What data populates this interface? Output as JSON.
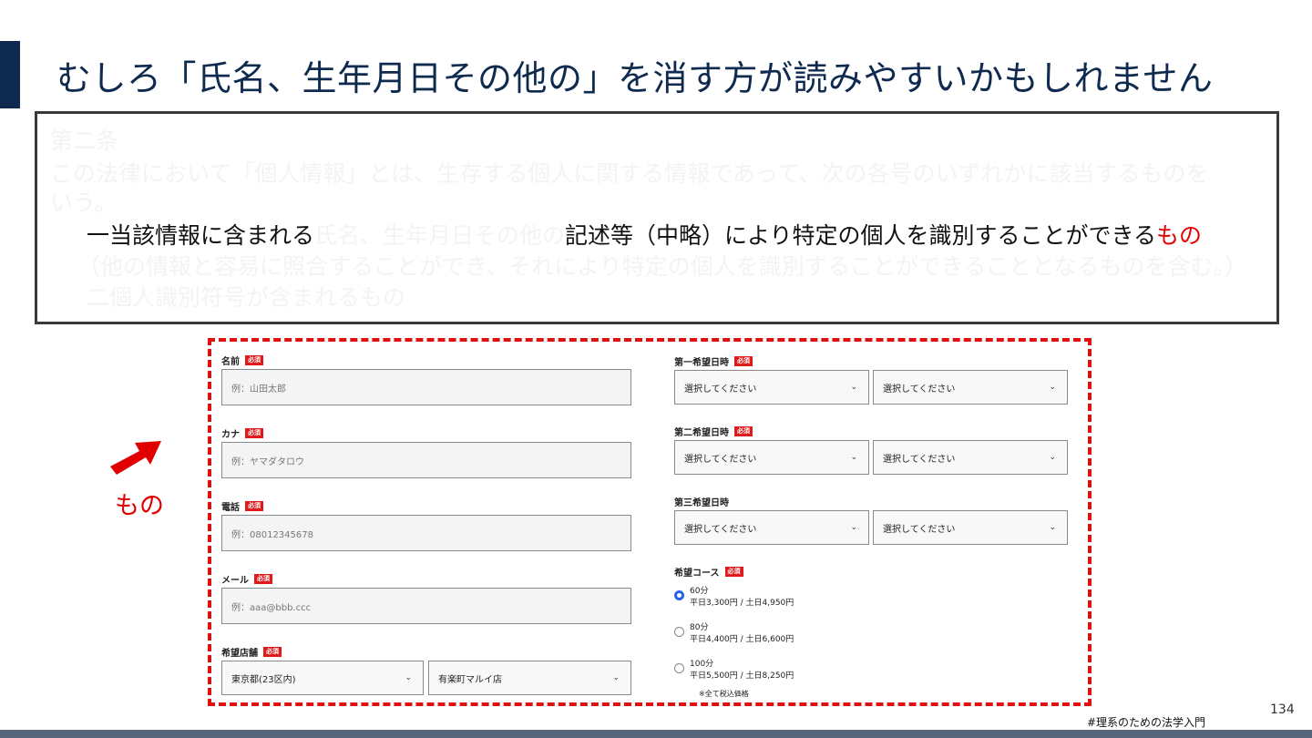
{
  "slide": {
    "title": "むしろ「氏名、生年月日その他の」を消す方が読みやすいかもしれません",
    "page_number": "134",
    "hashtag": "#理系のための法学入門"
  },
  "law": {
    "article": "第二条",
    "line1": "この法律において「個人情報」とは、生存する個人に関する情報であって、次の各号のいずれかに該当するものを",
    "line1b": "いう。",
    "item1_pre": "一当該情報に含まれる",
    "item1_faded": "氏名、生年月日その他の",
    "item1_post": "記述等（中略）により特定の個人を識別することができる",
    "item1_emph": "もの",
    "item1_cont": "（他の情報と容易に照合することができ、それにより特定の個人を識別することができることとなるものを含む。）",
    "item2": "二個人識別符号が含まれるもの"
  },
  "annotation": {
    "label": "もの",
    "arrow_icon": "arrow-up-right-icon"
  },
  "form": {
    "required_badge": "必須",
    "name": {
      "label": "名前",
      "placeholder": "例：山田太郎"
    },
    "kana": {
      "label": "カナ",
      "placeholder": "例：ヤマダタロウ"
    },
    "phone": {
      "label": "電話",
      "placeholder": "例：08012345678"
    },
    "email": {
      "label": "メール",
      "placeholder": "例：aaa@bbb.ccc"
    },
    "store": {
      "label": "希望店舗",
      "region": "東京都(23区内)",
      "shop": "有楽町マルイ店"
    },
    "date1": {
      "label": "第一希望日時",
      "date": "選択してください",
      "time": "選択してください"
    },
    "date2": {
      "label": "第二希望日時",
      "date": "選択してください",
      "time": "選択してください"
    },
    "date3": {
      "label": "第三希望日時",
      "date": "選択してください",
      "time": "選択してください"
    },
    "course": {
      "label": "希望コース",
      "options": [
        {
          "name": "60分",
          "price": "平日3,300円 / 土日4,950円",
          "selected": true
        },
        {
          "name": "80分",
          "price": "平日4,400円 / 土日6,600円",
          "selected": false
        },
        {
          "name": "100分",
          "price": "平日5,500円 / 土日8,250円",
          "selected": false
        }
      ],
      "note": "※全て税込価格"
    }
  },
  "colors": {
    "navy": "#0f2a4f",
    "red": "#e00000",
    "radio_selected": "#2563eb",
    "bottom_bar": "#56667c"
  }
}
